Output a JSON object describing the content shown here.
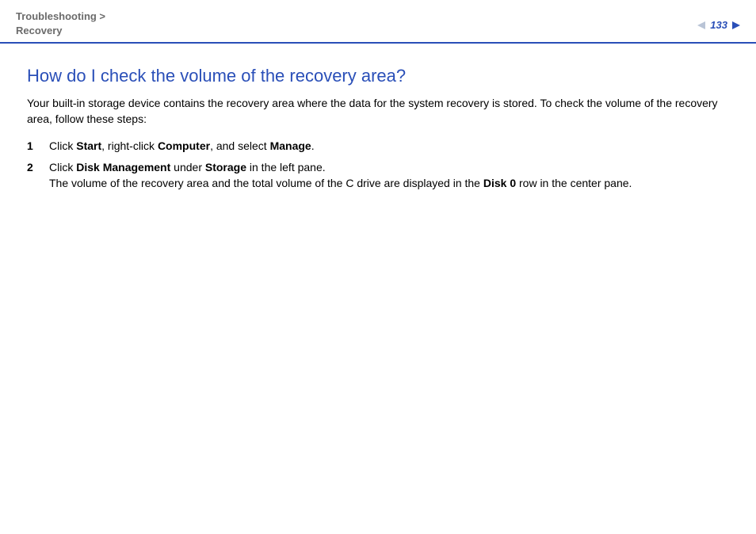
{
  "header": {
    "breadcrumb_line1": "Troubleshooting >",
    "breadcrumb_line2": "Recovery",
    "page_number": "133"
  },
  "content": {
    "title": "How do I check the volume of the recovery area?",
    "intro": "Your built-in storage device contains the recovery area where the data for the system recovery is stored. To check the volume of the recovery area, follow these steps:",
    "steps": [
      {
        "parts": [
          {
            "t": "Click "
          },
          {
            "t": "Start",
            "b": true
          },
          {
            "t": ", right-click "
          },
          {
            "t": "Computer",
            "b": true
          },
          {
            "t": ", and select "
          },
          {
            "t": "Manage",
            "b": true
          },
          {
            "t": "."
          }
        ]
      },
      {
        "parts": [
          {
            "t": "Click "
          },
          {
            "t": "Disk Management",
            "b": true
          },
          {
            "t": " under "
          },
          {
            "t": "Storage",
            "b": true
          },
          {
            "t": " in the left pane."
          }
        ],
        "extra": [
          {
            "t": "The volume of the recovery area and the total volume of the C drive are displayed in the "
          },
          {
            "t": "Disk 0",
            "b": true
          },
          {
            "t": " row in the center pane."
          }
        ]
      }
    ]
  }
}
